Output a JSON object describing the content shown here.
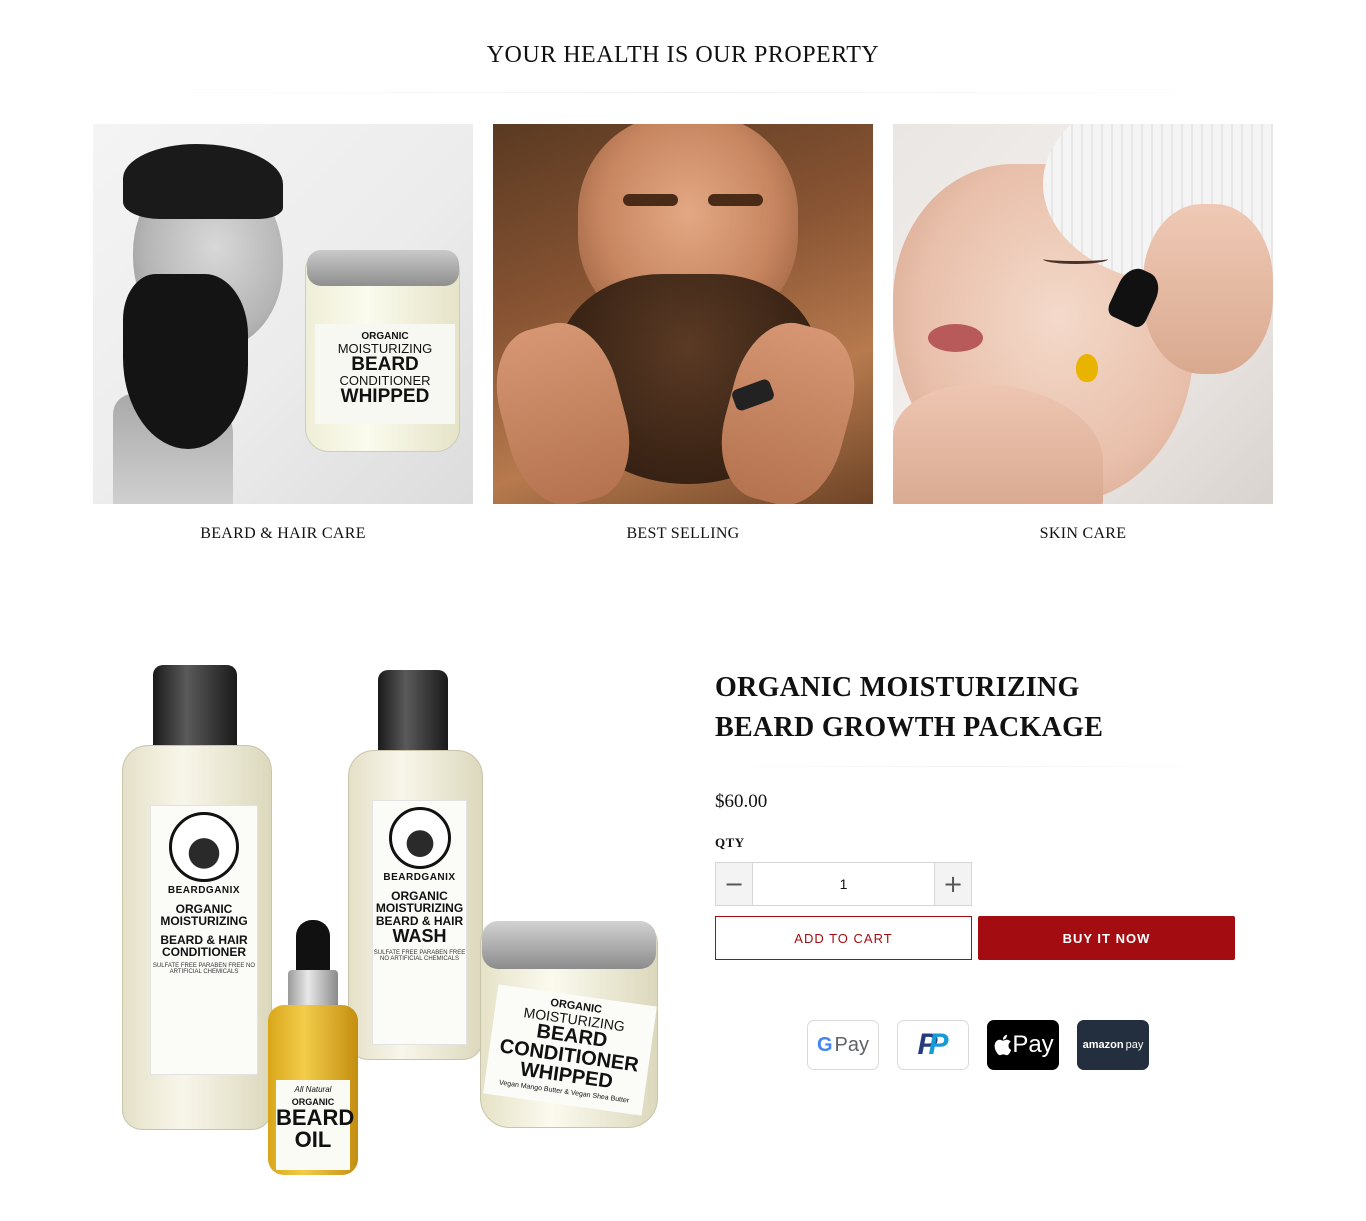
{
  "section": {
    "title": "YOUR HEALTH IS OUR PROPERTY"
  },
  "collections": [
    {
      "label": "BEARD & HAIR CARE"
    },
    {
      "label": "BEST SELLING"
    },
    {
      "label": "SKIN CARE"
    }
  ],
  "thumb_jar": {
    "line1": "ORGANIC",
    "line2": "MOISTURIZING",
    "line3": "BEARD",
    "line4": "CONDITIONER",
    "line5": "WHIPPED"
  },
  "product_image": {
    "conditioner": {
      "brand": "BEARDGANIX",
      "line1": "ORGANIC MOISTURIZING",
      "line2": "BEARD & HAIR CONDITIONER",
      "small": "SULFATE FREE PARABEN FREE NO ARTIFICIAL CHEMICALS"
    },
    "wash": {
      "brand": "BEARDGANIX",
      "line1": "ORGANIC MOISTURIZING BEARD & HAIR",
      "line2": "WASH",
      "small": "SULFATE FREE PARABEN FREE NO ARTIFICIAL CHEMICALS"
    },
    "oil": {
      "line1": "All Natural",
      "line2": "ORGANIC",
      "line3": "BEARD OIL"
    },
    "whipped": {
      "line1": "ORGANIC",
      "line2": "MOISTURIZING",
      "line3": "BEARD CONDITIONER WHIPPED",
      "small": "Vegan Mango Butter & Vegan Shea Butter"
    }
  },
  "product": {
    "title": "ORGANIC MOISTURIZING BEARD GROWTH PACKAGE",
    "price": "$60.00",
    "qty_label": "QTY",
    "qty_value": "1",
    "minus_icon": "minus-icon",
    "plus_icon": "plus-icon",
    "add_to_cart": "ADD TO CART",
    "buy_now": "BUY IT NOW"
  },
  "payments": {
    "gpay_g": "G",
    "gpay_text": "Pay",
    "paypal_p1": "P",
    "paypal_p2": "P",
    "apple_text": " Pay",
    "amazon_b": "amazon",
    "amazon_text": "pay"
  },
  "colors": {
    "accent": "#a30d12"
  }
}
